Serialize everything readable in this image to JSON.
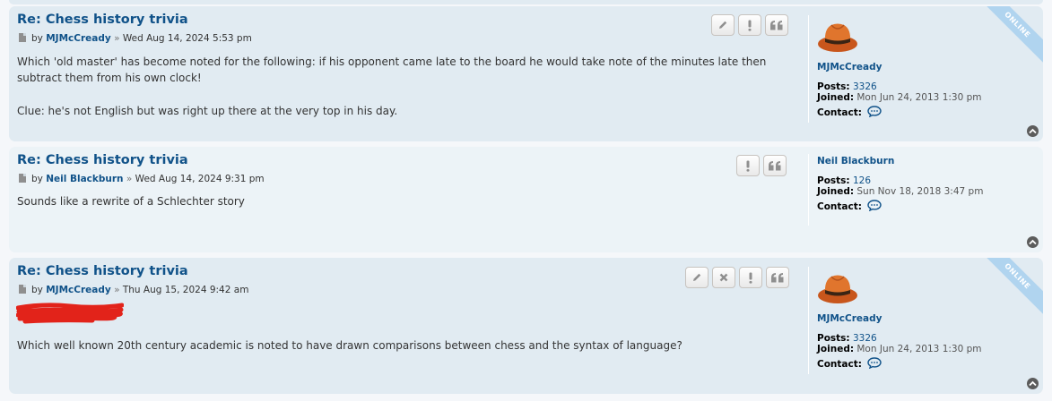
{
  "posts": [
    {
      "title": "Re: Chess history trivia",
      "by": "by",
      "author": "MJMcCready",
      "sep": "»",
      "date": "Wed Aug 14, 2024 5:53 pm",
      "content": [
        "Which 'old master' has become noted for the following: if his opponent came late to the board he would take note of the minutes late then subtract them from his own clock!",
        "Clue: he's not English but was right up there at the very top in his day."
      ],
      "profile": {
        "name": "MJMcCready",
        "posts_label": "Posts:",
        "posts": "3326",
        "joined_label": "Joined:",
        "joined": "Mon Jun 24, 2013 1:30 pm",
        "contact_label": "Contact:",
        "online": "ONLINE"
      }
    },
    {
      "title": "Re: Chess history trivia",
      "by": "by",
      "author": "Neil Blackburn",
      "sep": "»",
      "date": "Wed Aug 14, 2024 9:31 pm",
      "content": [
        "Sounds like a rewrite of a Schlechter story"
      ],
      "profile": {
        "name": "Neil Blackburn",
        "posts_label": "Posts:",
        "posts": "126",
        "joined_label": "Joined:",
        "joined": "Sun Nov 18, 2018 3:47 pm",
        "contact_label": "Contact:"
      }
    },
    {
      "title": "Re: Chess history trivia",
      "by": "by",
      "author": "MJMcCready",
      "sep": "»",
      "date": "Thu Aug 15, 2024 9:42 am",
      "content": [
        "Which well known 20th century academic is noted to have drawn comparisons between chess and the syntax of language?"
      ],
      "profile": {
        "name": "MJMcCready",
        "posts_label": "Posts:",
        "posts": "3326",
        "joined_label": "Joined:",
        "joined": "Mon Jun 24, 2013 1:30 pm",
        "contact_label": "Contact:",
        "online": "ONLINE"
      }
    }
  ],
  "colors": {
    "post_bg_1": "#e1ebf2",
    "post_bg_2": "#ecf3f7",
    "link": "#105289",
    "redaction": "#e2231a"
  },
  "icons": [
    "file-icon",
    "edit-icon",
    "delete-icon",
    "report-icon",
    "quote-icon",
    "contact-icon",
    "back-to-top-icon",
    "avatar-hat-icon"
  ]
}
